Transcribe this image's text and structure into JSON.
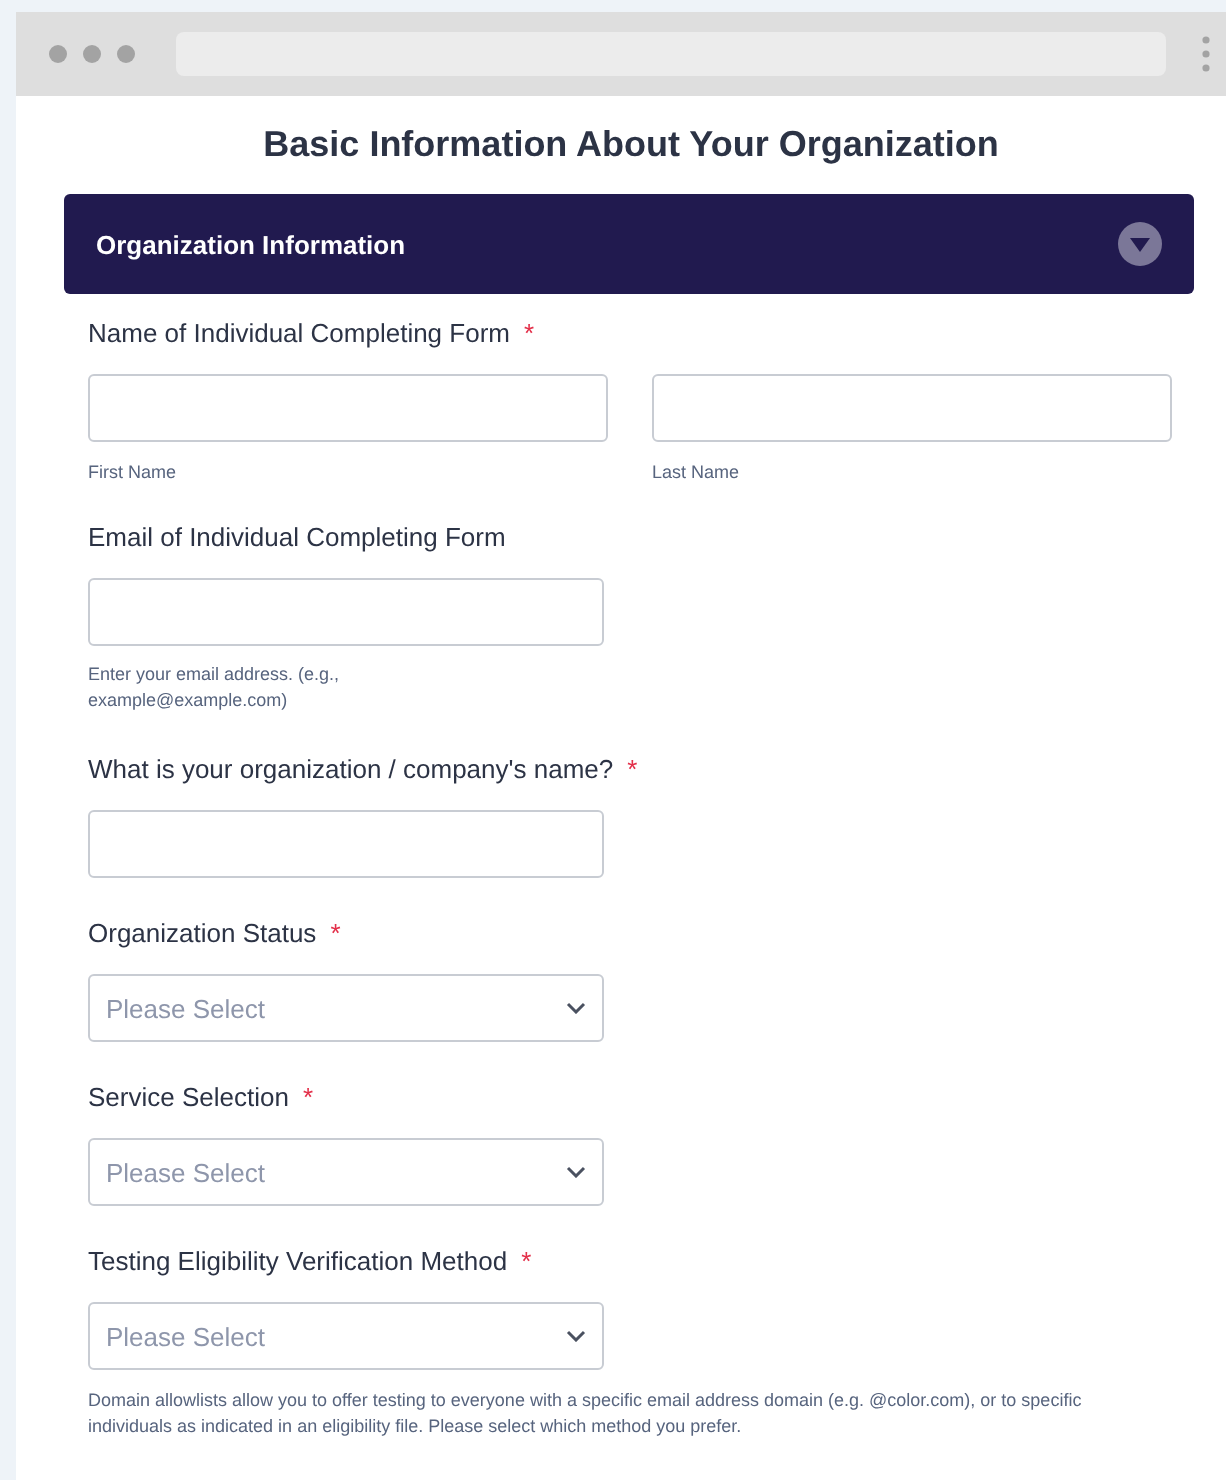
{
  "title": "Basic Information About Your Organization",
  "section": {
    "title": "Organization Information",
    "expanded": true
  },
  "fields": [
    {
      "kind": "name",
      "label": "Name of Individual Completing Form",
      "required_mark": "*",
      "parts": [
        {
          "sublabel": "First Name"
        },
        {
          "sublabel": "Last Name"
        }
      ]
    },
    {
      "kind": "text",
      "label": "Email of Individual Completing Form",
      "sublabel": "Enter your email address. (e.g., example@example.com)"
    },
    {
      "kind": "text",
      "label": "What is your organization / company's name?",
      "required_mark": "*"
    },
    {
      "kind": "select",
      "label": "Organization Status",
      "required_mark": "*",
      "placeholder": "Please Select"
    },
    {
      "kind": "select",
      "label": "Service Selection",
      "required_mark": "*",
      "placeholder": "Please Select"
    },
    {
      "kind": "select",
      "label": "Testing Eligibility Verification Method",
      "required_mark": "*",
      "placeholder": "Please Select",
      "description": "Domain allowlists allow you to offer testing to everyone with a specific email address domain (e.g. @color.com), or to specific individuals as indicated in an eligibility file. Please select which method you prefer."
    }
  ]
}
